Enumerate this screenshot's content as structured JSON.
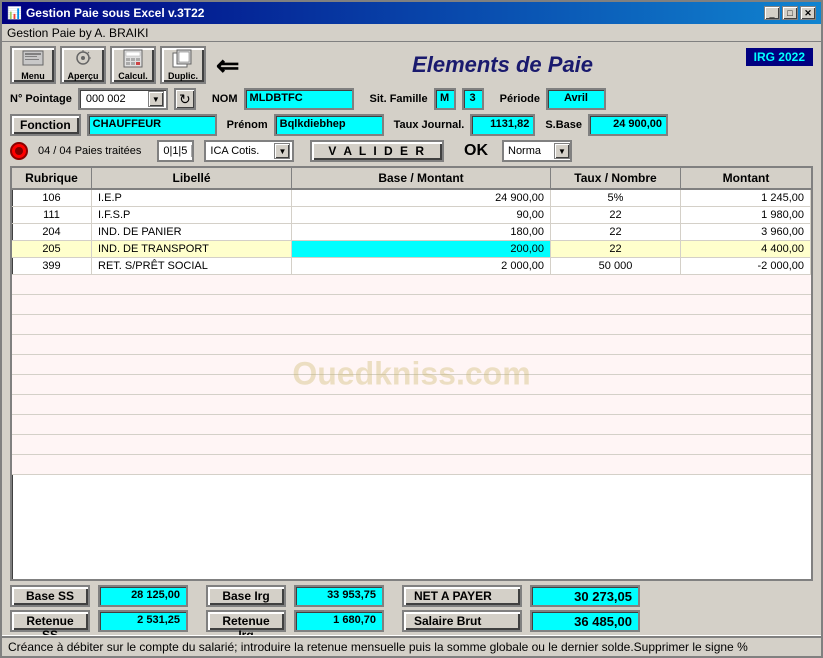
{
  "window": {
    "title": "Gestion Paie sous Excel v.3T22",
    "sub_title": "Gestion Paie by A. BRAIKI"
  },
  "toolbar": {
    "buttons": [
      {
        "id": "menu",
        "label": "Menu"
      },
      {
        "id": "apercu",
        "label": "Aperçu"
      },
      {
        "id": "calcul",
        "label": "Calcul."
      },
      {
        "id": "duplic",
        "label": "Duplic."
      }
    ],
    "irg_badge": "IRG 2022",
    "page_title": "Elements de Paie"
  },
  "form": {
    "n_pointage_label": "N° Pointage",
    "n_pointage_value": "000 002",
    "nom_label": "NOM",
    "nom_value": "MLDBTFC",
    "sit_famille_label": "Sit. Famille",
    "sit_famille_value": "M",
    "sit_famille_num": "3",
    "periode_label": "Période",
    "periode_value": "Avril",
    "fonction_label": "Fonction",
    "fonction_value": "CHAUFFEUR",
    "prenom_label": "Prénom",
    "prenom_value": "Bqlkdiebhep",
    "taux_journal_label": "Taux Journal.",
    "taux_journal_value": "1131,82",
    "s_base_label": "S.Base",
    "s_base_value": "24 900,00",
    "paies_label": "04 / 04  Paies traitées",
    "ica_value": "0|1|5",
    "ica_cotis": "ICA Cotis.",
    "valider_label": "V A L I D E R",
    "ok_label": "OK",
    "norma_value": "Norma"
  },
  "table": {
    "headers": [
      "Rubrique",
      "Libellé",
      "Base / Montant",
      "Taux / Nombre",
      "Montant"
    ],
    "rows": [
      {
        "rubrique": "106",
        "libelle": "I.E.P",
        "base": "24 900,00",
        "taux": "5%",
        "montant": "1 245,00",
        "highlight": ""
      },
      {
        "rubrique": "111",
        "libelle": "I.F.S.P",
        "base": "90,00",
        "taux": "22",
        "montant": "1 980,00",
        "highlight": ""
      },
      {
        "rubrique": "204",
        "libelle": "IND. DE PANIER",
        "base": "180,00",
        "taux": "22",
        "montant": "3 960,00",
        "highlight": ""
      },
      {
        "rubrique": "205",
        "libelle": "IND. DE TRANSPORT",
        "base": "200,00",
        "taux": "22",
        "montant": "4 400,00",
        "highlight": "yellow"
      },
      {
        "rubrique": "399",
        "libelle": "RET. S/PRÊT SOCIAL",
        "base": "2 000,00",
        "taux": "50 000",
        "montant": "-2 000,00",
        "highlight": ""
      }
    ],
    "empty_rows": 10
  },
  "bottom": {
    "base_ss_label": "Base SS",
    "base_ss_value": "28 125,00",
    "base_irg_label": "Base Irg",
    "base_irg_value": "33 953,75",
    "net_payer_label": "NET A PAYER",
    "net_payer_value": "30 273,05",
    "retenue_ss_label": "Retenue SS",
    "retenue_ss_value": "2 531,25",
    "retenue_irg_label": "Retenue Irg",
    "retenue_irg_value": "1 680,70",
    "salaire_brut_label": "Salaire Brut",
    "salaire_brut_value": "36 485,00"
  },
  "status_bar": {
    "text": "Créance à débiter sur le compte du salarié; introduire la retenue mensuelle puis la somme globale ou le dernier solde.Supprimer le signe %"
  },
  "watermark": "Ouedkniss.com"
}
